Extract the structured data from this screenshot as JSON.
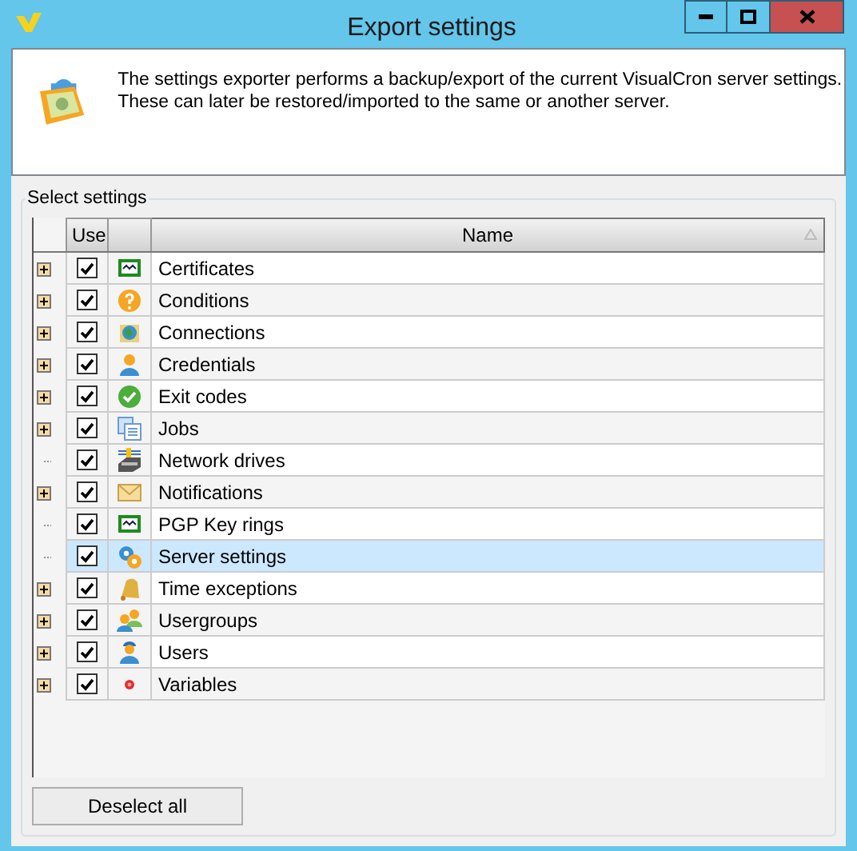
{
  "window": {
    "title": "Export settings"
  },
  "description": "The settings exporter performs a backup/export of the current VisualCron server settings. These can later be restored/imported to the same or another server.",
  "group": {
    "label": "Select settings"
  },
  "table": {
    "columns": [
      "Use",
      "Name"
    ],
    "rows": [
      {
        "name": "Certificates",
        "checked": true,
        "expandable": true,
        "selected": false
      },
      {
        "name": "Conditions",
        "checked": true,
        "expandable": true,
        "selected": false
      },
      {
        "name": "Connections",
        "checked": true,
        "expandable": true,
        "selected": false
      },
      {
        "name": "Credentials",
        "checked": true,
        "expandable": true,
        "selected": false
      },
      {
        "name": "Exit codes",
        "checked": true,
        "expandable": true,
        "selected": false
      },
      {
        "name": "Jobs",
        "checked": true,
        "expandable": true,
        "selected": false
      },
      {
        "name": "Network drives",
        "checked": true,
        "expandable": false,
        "selected": false
      },
      {
        "name": "Notifications",
        "checked": true,
        "expandable": true,
        "selected": false
      },
      {
        "name": "PGP Key rings",
        "checked": true,
        "expandable": false,
        "selected": false
      },
      {
        "name": "Server settings",
        "checked": true,
        "expandable": false,
        "selected": true
      },
      {
        "name": "Time exceptions",
        "checked": true,
        "expandable": true,
        "selected": false
      },
      {
        "name": "Usergroups",
        "checked": true,
        "expandable": true,
        "selected": false
      },
      {
        "name": "Users",
        "checked": true,
        "expandable": true,
        "selected": false
      },
      {
        "name": "Variables",
        "checked": true,
        "expandable": true,
        "selected": false
      }
    ]
  },
  "buttons": [
    "Deselect all"
  ]
}
